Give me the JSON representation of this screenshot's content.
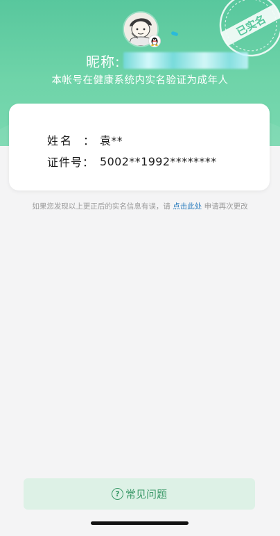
{
  "profile": {
    "nickname_label": "昵称:",
    "nickname_value": "",
    "verified_subtitle": "本帐号在健康系统内实名验证为成年人",
    "stamp_text": "已实名",
    "avatar_icon": "avatar-icon",
    "badge_icon": "qq-penguin-icon"
  },
  "card": {
    "name_label": "姓名",
    "name_colon": "：",
    "name_value": "袁**",
    "id_label": "证件号：",
    "id_value": "5002**1992********"
  },
  "notice": {
    "before_link": "如果您发现以上更正后的实名信息有误，请 ",
    "link_text": "点击此处",
    "after_link": " 申请再次更改"
  },
  "footer": {
    "faq_label": "常见问题",
    "faq_icon": "question-circle-icon"
  },
  "colors": {
    "brand_green": "#58c79d",
    "link_blue": "#2f7fbf",
    "faq_bg": "#ddf1e6"
  }
}
